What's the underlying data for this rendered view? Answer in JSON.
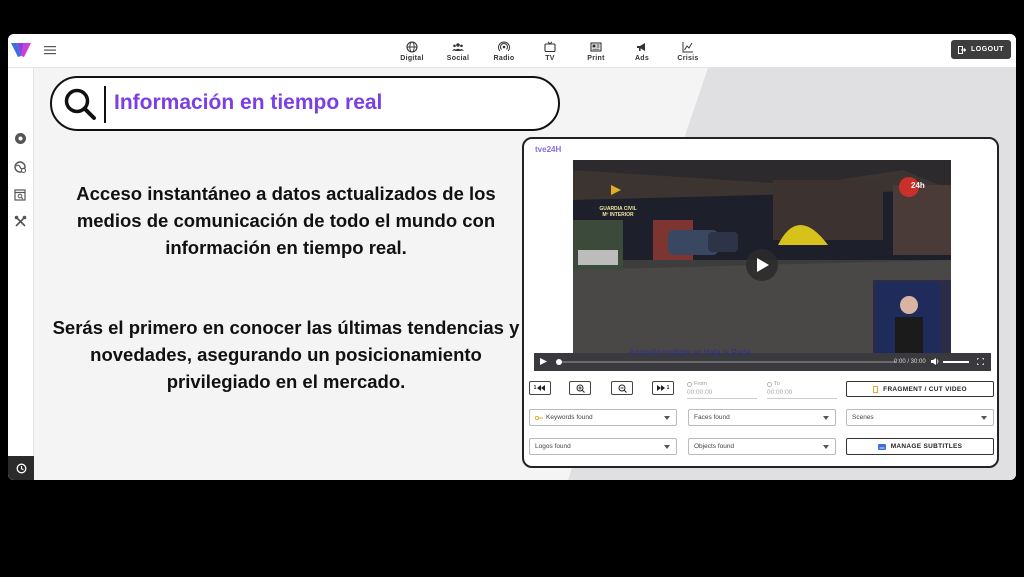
{
  "nav": [
    {
      "label": "Digital",
      "icon": "globe-icon"
    },
    {
      "label": "Social",
      "icon": "people-icon"
    },
    {
      "label": "Radio",
      "icon": "radio-icon"
    },
    {
      "label": "TV",
      "icon": "tv-icon"
    },
    {
      "label": "Print",
      "icon": "newspaper-icon"
    },
    {
      "label": "Ads",
      "icon": "megaphone-icon"
    },
    {
      "label": "Crisis",
      "icon": "chart-icon"
    }
  ],
  "logout_label": "LOGOUT",
  "banner_title": "Información en tiempo real",
  "paragraph1": "Acceso instantáneo a datos actualizados de los medios de comunicación de todo el mundo con información en tiempo real.",
  "paragraph2": "Serás el primero en conocer las últimas tendencias y novedades, asegurando un posicionamiento privilegiado en el mercado.",
  "player": {
    "channel": "tve24H",
    "overlay_text": "GUARDIA CIVIL\nMº INTERIOR",
    "badge": "24h",
    "subtitle": "Atropello múltiple en Hafa la Reda",
    "time": "0:00 / 30:00",
    "from_label": "From",
    "from_value": "00:00:00",
    "to_label": "To",
    "to_value": "00:00:00",
    "fragment_label": "FRAGMENT / CUT VIDEO",
    "prev_label": "1",
    "next_label": "1"
  },
  "filters": {
    "keywords": "Keywords found",
    "faces": "Faces found",
    "scenes": "Scenes",
    "logos": "Logos found",
    "objects": "Objects found",
    "subtitles": "MANAGE SUBTITLES"
  },
  "colors": {
    "accent": "#7b3fe4",
    "dark": "#3d3d3d"
  }
}
